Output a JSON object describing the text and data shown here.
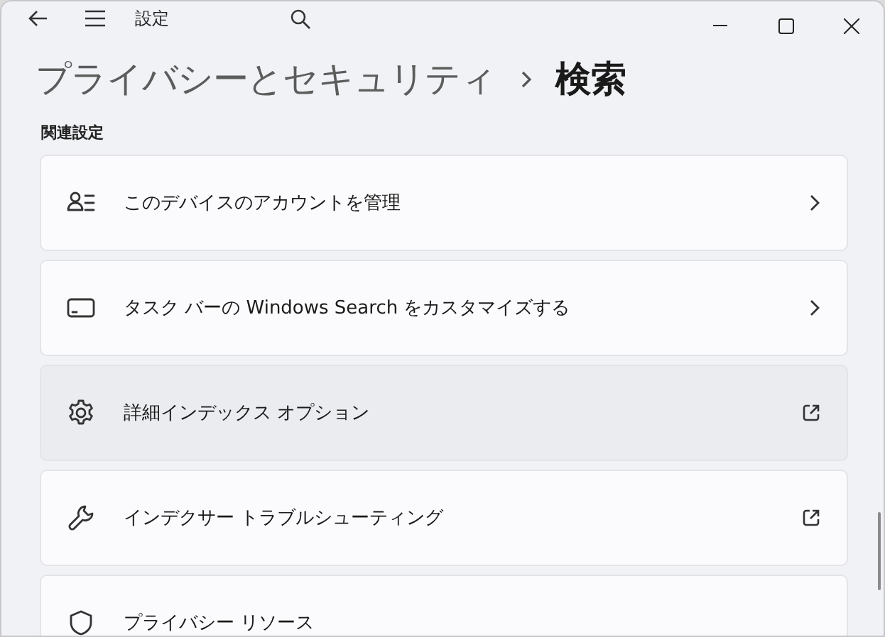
{
  "window": {
    "title": "設定"
  },
  "breadcrumb": {
    "parent": "プライバシーとセキュリティ",
    "current": "検索"
  },
  "section": {
    "heading": "関連設定"
  },
  "items": [
    {
      "kind": "page",
      "label": "このデバイスのアカウントを管理",
      "highlighted": false
    },
    {
      "kind": "page",
      "label": "タスク バーの Windows Search をカスタマイズする",
      "highlighted": false
    },
    {
      "kind": "external",
      "label": "詳細インデックス オプション",
      "highlighted": true
    },
    {
      "kind": "external",
      "label": "インデクサー トラブルシューティング",
      "highlighted": false
    },
    {
      "kind": "group",
      "label": "プライバシー リソース",
      "highlighted": false
    }
  ]
}
